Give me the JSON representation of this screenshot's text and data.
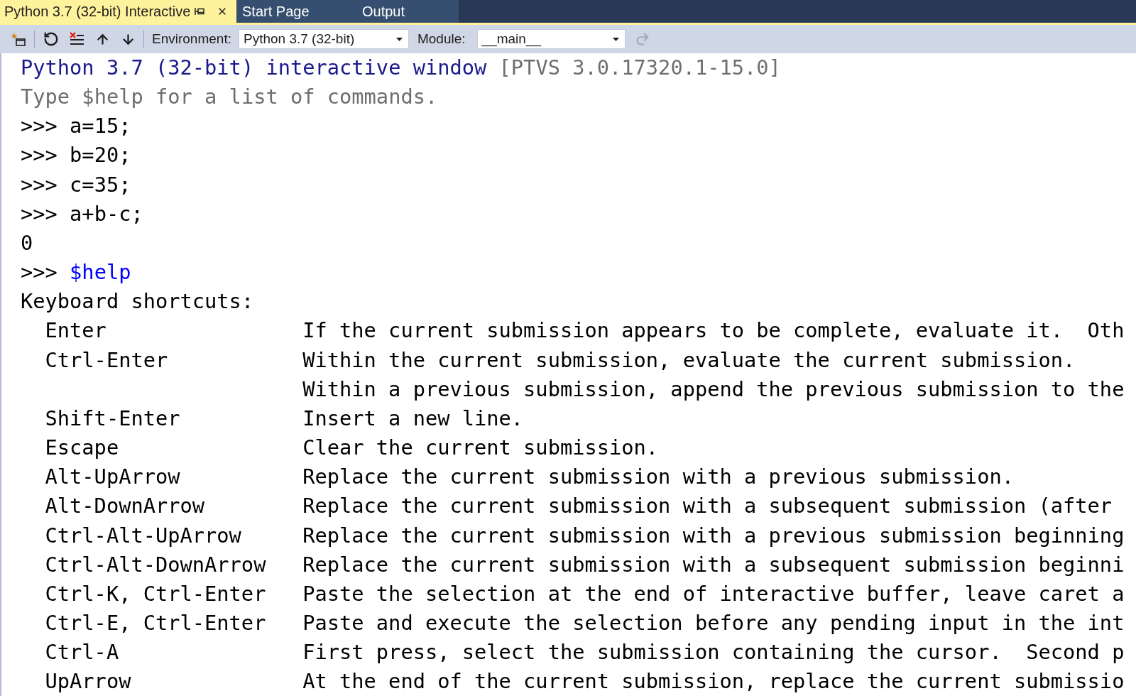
{
  "tabs": [
    {
      "label": "Python 3.7 (32-bit) Interactive",
      "selected": true
    },
    {
      "label": "Start Page",
      "selected": false
    },
    {
      "label": "Output",
      "selected": false
    }
  ],
  "toolbar": {
    "left_buttons": [
      {
        "kind": "new",
        "disabled": false
      },
      {
        "kind": "reset",
        "disabled": false
      },
      {
        "kind": "clear",
        "disabled": false
      },
      {
        "kind": "up",
        "disabled": false
      },
      {
        "kind": "down",
        "disabled": false
      }
    ],
    "environment_label": "Environment:",
    "environment": "Python 3.7 (32-bit)",
    "module_label": "Module:",
    "module": "__main__",
    "right_buttons": [
      {
        "kind": "redo",
        "disabled": true
      }
    ]
  },
  "console": {
    "banner": "Python 3.7 (32-bit) interactive window",
    "version": "[PTVS 3.0.17320.1-15.0]",
    "hint": "Type $help for a list of commands.",
    "lines": [
      {
        "kind": "input",
        "prompt": ">>>",
        "code": "a=15;"
      },
      {
        "kind": "input",
        "prompt": ">>>",
        "code": "b=20;"
      },
      {
        "kind": "input",
        "prompt": ">>>",
        "code": "c=35;"
      },
      {
        "kind": "input",
        "prompt": ">>>",
        "code": "a+b-c;"
      },
      {
        "kind": "output",
        "text": "0"
      },
      {
        "kind": "command",
        "prompt": ">>>",
        "code": "$help"
      },
      {
        "kind": "output",
        "text": "Keyboard shortcuts:"
      }
    ],
    "shortcuts": [
      {
        "keys": "Enter",
        "description": [
          "If the current submission appears to be complete, evaluate it.  Oth"
        ]
      },
      {
        "keys": "Ctrl-Enter",
        "description": [
          "Within the current submission, evaluate the current submission.",
          "Within a previous submission, append the previous submission to the"
        ]
      },
      {
        "keys": "Shift-Enter",
        "description": [
          "Insert a new line."
        ]
      },
      {
        "keys": "Escape",
        "description": [
          "Clear the current submission."
        ]
      },
      {
        "keys": "Alt-UpArrow",
        "description": [
          "Replace the current submission with a previous submission."
        ]
      },
      {
        "keys": "Alt-DownArrow",
        "description": [
          "Replace the current submission with a subsequent submission (after"
        ]
      },
      {
        "keys": "Ctrl-Alt-UpArrow",
        "description": [
          "Replace the current submission with a previous submission beginning"
        ]
      },
      {
        "keys": "Ctrl-Alt-DownArrow",
        "description": [
          "Replace the current submission with a subsequent submission beginni"
        ]
      },
      {
        "keys": "Ctrl-K, Ctrl-Enter",
        "description": [
          "Paste the selection at the end of interactive buffer, leave caret a"
        ]
      },
      {
        "keys": "Ctrl-E, Ctrl-Enter",
        "description": [
          "Paste and execute the selection before any pending input in the int"
        ]
      },
      {
        "keys": "Ctrl-A",
        "description": [
          "First press, select the submission containing the cursor.  Second p"
        ]
      },
      {
        "keys": "UpArrow",
        "description": [
          "At the end of the current submission, replace the current submissio"
        ]
      }
    ]
  }
}
